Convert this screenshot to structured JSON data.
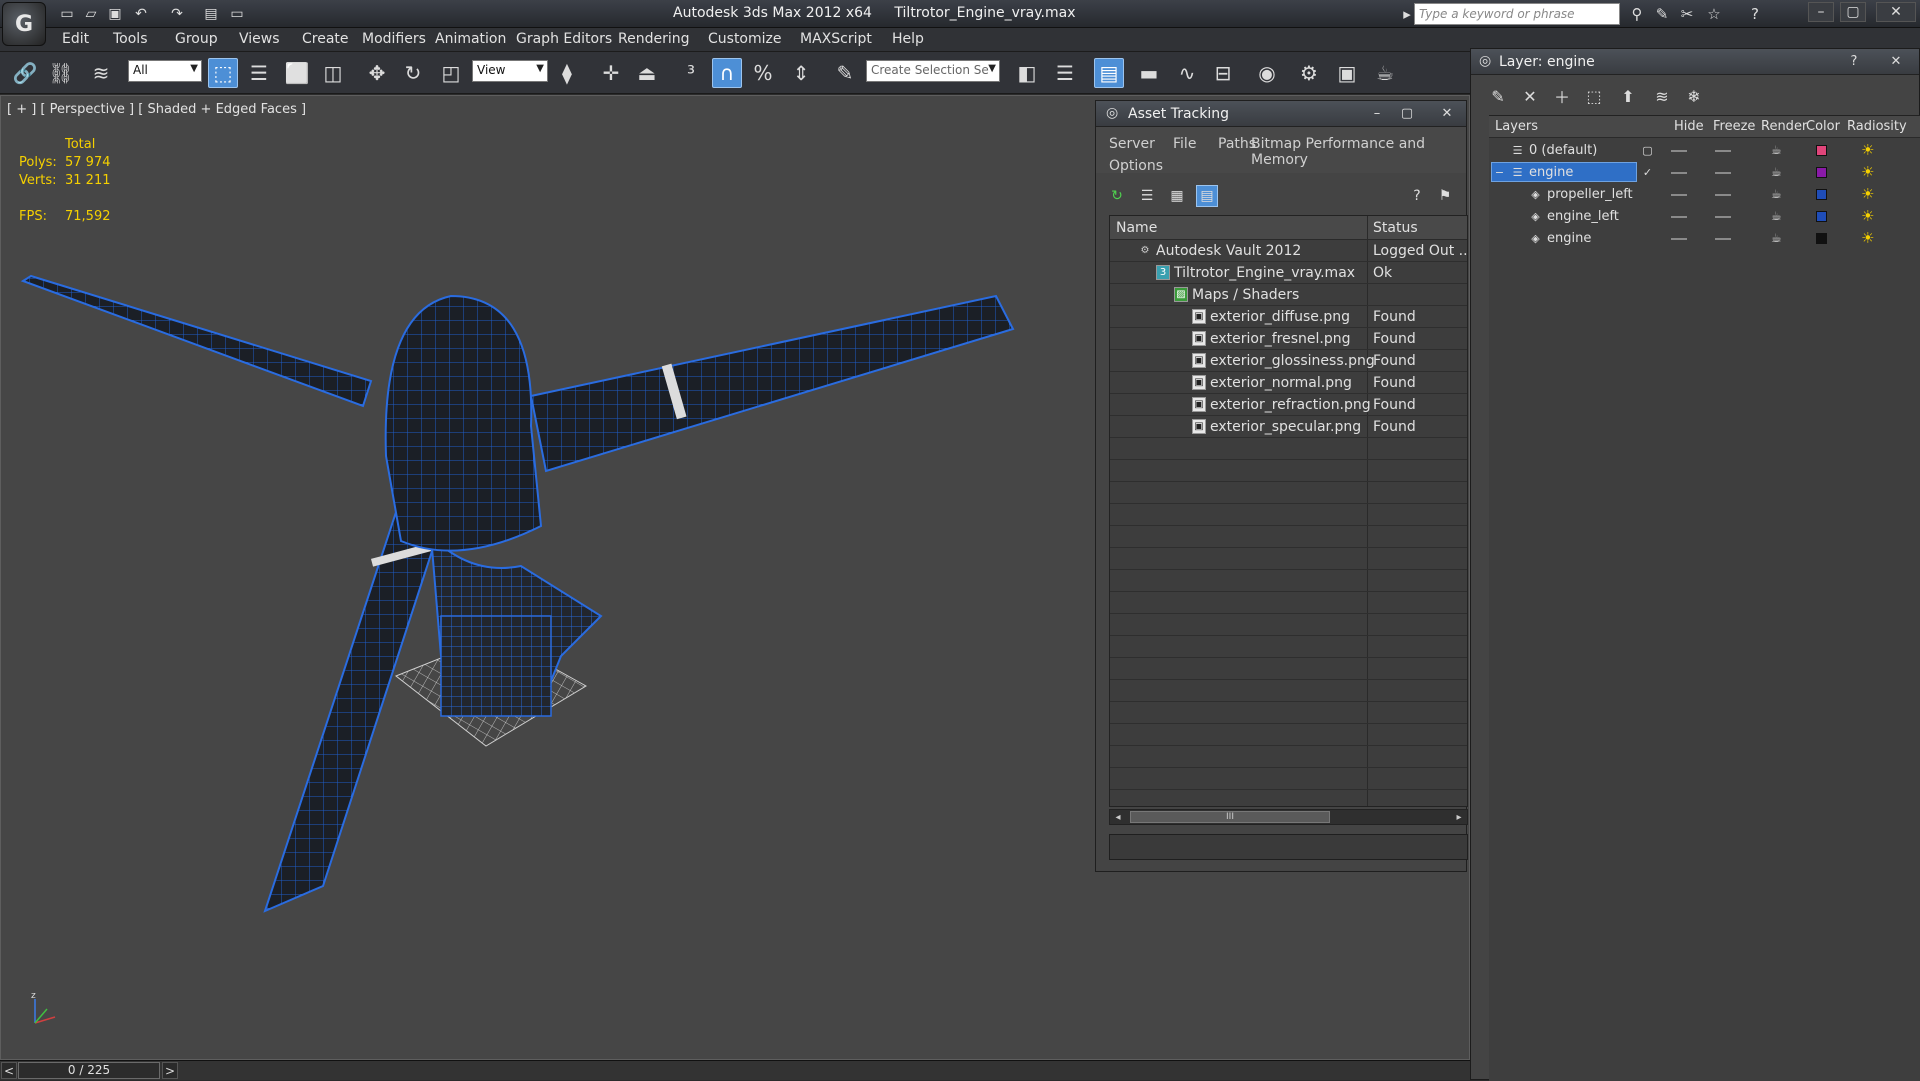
{
  "titlebar": {
    "app_title": "Autodesk 3ds Max  2012 x64",
    "file_name": "Tiltrotor_Engine_vray.max",
    "search_placeholder": "Type a keyword or phrase"
  },
  "menu": [
    "Edit",
    "Tools",
    "Group",
    "Views",
    "Create",
    "Modifiers",
    "Animation",
    "Graph Editors",
    "Rendering",
    "Customize",
    "MAXScript",
    "Help"
  ],
  "toolbar": {
    "selection_filter": "All",
    "reference_coord": "View",
    "named_selection_placeholder": "Create Selection Se"
  },
  "viewport": {
    "label": "[ + ] [ Perspective ] [ Shaded + Edged Faces ]",
    "stats_header": "Total",
    "polys_label": "Polys:",
    "polys_value": "57 974",
    "verts_label": "Verts:",
    "verts_value": "31 211",
    "fps_label": "FPS:",
    "fps_value": "71,592",
    "axis_label": "z"
  },
  "timeline": {
    "frame": "0 / 225",
    "prev": "<",
    "next": ">"
  },
  "asset_tracking": {
    "title": "Asset Tracking",
    "menu": [
      "Server",
      "File",
      "Paths",
      "Bitmap Performance and Memory",
      "Options"
    ],
    "columns": {
      "name": "Name",
      "status": "Status"
    },
    "rows": [
      {
        "name": "Autodesk Vault 2012",
        "status": "Logged Out ...",
        "indent": 0,
        "icon": "vault-icon"
      },
      {
        "name": "Tiltrotor_Engine_vray.max",
        "status": "Ok",
        "indent": 1,
        "icon": "max-file-icon"
      },
      {
        "name": "Maps / Shaders",
        "status": "",
        "indent": 2,
        "icon": "maps-icon"
      },
      {
        "name": "exterior_diffuse.png",
        "status": "Found",
        "indent": 3,
        "icon": "image-file-icon"
      },
      {
        "name": "exterior_fresnel.png",
        "status": "Found",
        "indent": 3,
        "icon": "image-file-icon"
      },
      {
        "name": "exterior_glossiness.png",
        "status": "Found",
        "indent": 3,
        "icon": "image-file-icon"
      },
      {
        "name": "exterior_normal.png",
        "status": "Found",
        "indent": 3,
        "icon": "image-file-icon"
      },
      {
        "name": "exterior_refraction.png",
        "status": "Found",
        "indent": 3,
        "icon": "image-file-icon"
      },
      {
        "name": "exterior_specular.png",
        "status": "Found",
        "indent": 3,
        "icon": "image-file-icon"
      }
    ],
    "scroll_grip": "III"
  },
  "layer_panel": {
    "title": "Layer: engine",
    "help": "?",
    "columns": [
      "Layers",
      "Hide",
      "Freeze",
      "Render",
      "Color",
      "Radiosity"
    ],
    "rows": [
      {
        "name": "0 (default)",
        "color": "#e0457a",
        "indent": 0,
        "selected": false
      },
      {
        "name": "engine",
        "color": "#8a1aa8",
        "indent": 0,
        "selected": true
      },
      {
        "name": "propeller_left",
        "color": "#1f4db8",
        "indent": 1,
        "selected": false
      },
      {
        "name": "engine_left",
        "color": "#1f4db8",
        "indent": 1,
        "selected": false
      },
      {
        "name": "engine",
        "color": "#111111",
        "indent": 1,
        "selected": false
      }
    ]
  },
  "colors": {
    "wire_blue": "#1a4fb0",
    "stats_yellow": "#f5d000",
    "selection_blue": "#2f6fc6"
  }
}
